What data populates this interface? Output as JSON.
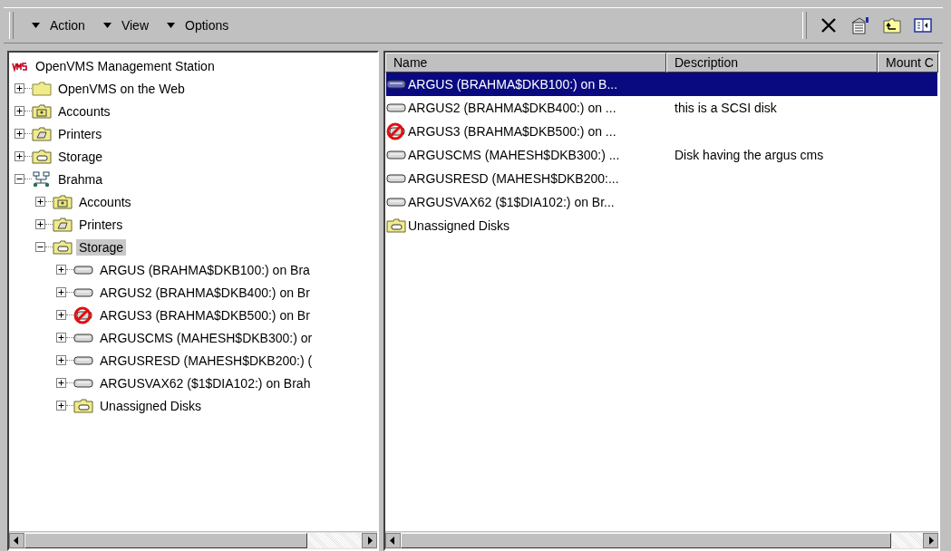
{
  "toolbar": {
    "menus": [
      {
        "label": "Action"
      },
      {
        "label": "View"
      },
      {
        "label": "Options"
      }
    ]
  },
  "tree": {
    "root": {
      "label": "OpenVMS Management Station",
      "kind": "vms",
      "selected": false,
      "children": [
        {
          "label": "OpenVMS on the Web",
          "kind": "folder",
          "expanded": false,
          "selected": false
        },
        {
          "label": "Accounts",
          "kind": "accounts",
          "expanded": false,
          "selected": false
        },
        {
          "label": "Printers",
          "kind": "printers",
          "expanded": false,
          "selected": false
        },
        {
          "label": "Storage",
          "kind": "storage",
          "expanded": false,
          "selected": false
        },
        {
          "label": "Brahma",
          "kind": "network",
          "expanded": true,
          "selected": false,
          "children": [
            {
              "label": "Accounts",
              "kind": "accounts",
              "expanded": false,
              "selected": false
            },
            {
              "label": "Printers",
              "kind": "printers",
              "expanded": false,
              "selected": false
            },
            {
              "label": "Storage",
              "kind": "storage",
              "expanded": true,
              "selected": true,
              "children": [
                {
                  "label": "ARGUS (BRAHMA$DKB100:) on Bra",
                  "kind": "disk",
                  "expanded": false,
                  "selected": false
                },
                {
                  "label": "ARGUS2 (BRAHMA$DKB400:) on Br",
                  "kind": "disk",
                  "expanded": false,
                  "selected": false
                },
                {
                  "label": "ARGUS3 (BRAHMA$DKB500:) on Br",
                  "kind": "disk-error",
                  "expanded": false,
                  "selected": false
                },
                {
                  "label": "ARGUSCMS (MAHESH$DKB300:) or",
                  "kind": "disk",
                  "expanded": false,
                  "selected": false
                },
                {
                  "label": "ARGUSRESD (MAHESH$DKB200:) (",
                  "kind": "disk",
                  "expanded": false,
                  "selected": false
                },
                {
                  "label": "ARGUSVAX62 ($1$DIA102:) on Brah",
                  "kind": "disk",
                  "expanded": false,
                  "selected": false
                },
                {
                  "label": "Unassigned Disks",
                  "kind": "storage",
                  "expanded": false,
                  "selected": false
                }
              ]
            }
          ]
        }
      ]
    }
  },
  "list": {
    "columns": [
      "Name",
      "Description",
      "Mount C"
    ],
    "rows": [
      {
        "name": "ARGUS (BRAHMA$DKB100:) on B...",
        "kind": "disk",
        "selected": true
      },
      {
        "name": "ARGUS2 (BRAHMA$DKB400:) on ...",
        "description": "this is a SCSI disk",
        "kind": "disk",
        "selected": false
      },
      {
        "name": "ARGUS3 (BRAHMA$DKB500:) on ...",
        "kind": "disk-error",
        "selected": false
      },
      {
        "name": "ARGUSCMS (MAHESH$DKB300:) ...",
        "description": "Disk having the argus cms",
        "kind": "disk",
        "selected": false
      },
      {
        "name": "ARGUSRESD (MAHESH$DKB200:...",
        "kind": "disk",
        "selected": false
      },
      {
        "name": "ARGUSVAX62 ($1$DIA102:) on Br...",
        "kind": "disk",
        "selected": false
      },
      {
        "name": "Unassigned Disks",
        "kind": "storage",
        "selected": false
      }
    ]
  }
}
